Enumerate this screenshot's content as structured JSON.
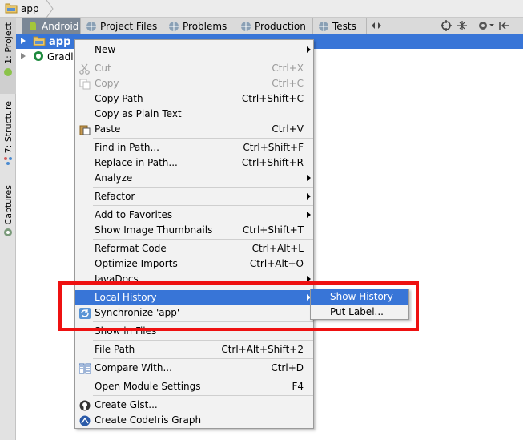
{
  "breadcrumb": {
    "label": "app"
  },
  "left_strip": {
    "tabs": [
      {
        "label": "1: Project"
      },
      {
        "label": "7: Structure"
      },
      {
        "label": "Captures"
      }
    ]
  },
  "tabs": [
    {
      "label": "Android"
    },
    {
      "label": "Project Files"
    },
    {
      "label": "Problems"
    },
    {
      "label": "Production"
    },
    {
      "label": "Tests"
    }
  ],
  "tree": [
    {
      "label": "app"
    },
    {
      "label": "Gradl"
    }
  ],
  "menu": [
    {
      "label": "New",
      "shortcut": "",
      "submenu": true
    },
    {
      "label": "Cut",
      "shortcut": "Ctrl+X",
      "disabled": true
    },
    {
      "label": "Copy",
      "shortcut": "Ctrl+C",
      "disabled": true
    },
    {
      "label": "Copy Path",
      "shortcut": "Ctrl+Shift+C"
    },
    {
      "label": "Copy as Plain Text",
      "shortcut": ""
    },
    {
      "label": "Paste",
      "shortcut": "Ctrl+V"
    },
    {
      "label": "Find in Path...",
      "shortcut": "Ctrl+Shift+F"
    },
    {
      "label": "Replace in Path...",
      "shortcut": "Ctrl+Shift+R"
    },
    {
      "label": "Analyze",
      "shortcut": "",
      "submenu": true
    },
    {
      "label": "Refactor",
      "shortcut": "",
      "submenu": true
    },
    {
      "label": "Add to Favorites",
      "shortcut": "",
      "submenu": true
    },
    {
      "label": "Show Image Thumbnails",
      "shortcut": "Ctrl+Shift+T"
    },
    {
      "label": "Reformat Code",
      "shortcut": "Ctrl+Alt+L"
    },
    {
      "label": "Optimize Imports",
      "shortcut": "Ctrl+Alt+O"
    },
    {
      "label": "JavaDocs",
      "shortcut": "",
      "submenu": true
    },
    {
      "label": "Local History",
      "shortcut": "",
      "submenu": true,
      "highlighted": true
    },
    {
      "label": "Synchronize 'app'",
      "shortcut": ""
    },
    {
      "label": "Show in Files",
      "shortcut": ""
    },
    {
      "label": "File Path",
      "shortcut": "Ctrl+Alt+Shift+2"
    },
    {
      "label": "Compare With...",
      "shortcut": "Ctrl+D"
    },
    {
      "label": "Open Module Settings",
      "shortcut": "F4"
    },
    {
      "label": "Create Gist...",
      "shortcut": ""
    },
    {
      "label": "Create CodeIris Graph",
      "shortcut": ""
    }
  ],
  "submenu": [
    {
      "label": "Show History",
      "highlighted": true
    },
    {
      "label": "Put Label..."
    }
  ],
  "colors": {
    "selection": "#3875d7",
    "annotation": "#ee1111",
    "android_green": "#8bc34a"
  }
}
